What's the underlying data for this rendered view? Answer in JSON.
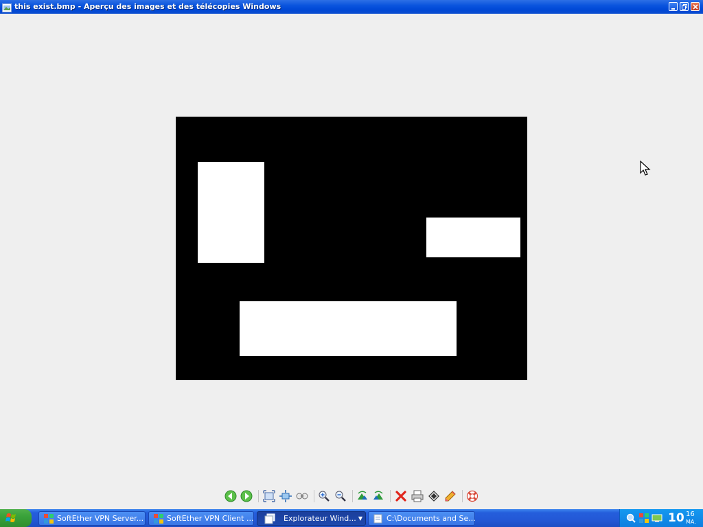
{
  "window": {
    "title": "this exist.bmp - Aperçu des images et des télécopies Windows",
    "buttons": [
      "minimize",
      "restore",
      "close"
    ]
  },
  "image": {
    "background_color": "#000000",
    "shape_color": "#ffffff"
  },
  "toolbar": {
    "buttons": [
      "previous-image",
      "next-image",
      "best-fit",
      "actual-size",
      "start-slideshow",
      "zoom-in",
      "zoom-out",
      "rotate-clockwise",
      "rotate-counterclockwise",
      "delete",
      "print",
      "copy-to",
      "edit",
      "help"
    ]
  },
  "taskbar": {
    "start_label": "",
    "tasks": [
      {
        "label": "SoftEther VPN Server...",
        "icon": "softether-icon",
        "active": false
      },
      {
        "label": "SoftEther VPN Client ...",
        "icon": "softether-icon",
        "active": false
      },
      {
        "label": "Explorateur Wind...",
        "icon": "explorer-group-icon",
        "active": true
      },
      {
        "label": "C:\\Documents and Se...",
        "icon": "folder-icon",
        "active": false
      }
    ],
    "tray": {
      "icons": [
        "search-tray-icon",
        "network-tray-icon",
        "monitor-tray-icon"
      ],
      "clock_hour": "10",
      "clock_minute": "16",
      "clock_ampm": "MA."
    }
  },
  "colors": {
    "titlebar_blue": "#0a54de",
    "desktop_bg": "#efefef",
    "taskbar_blue": "#245edc",
    "start_green": "#39a23a"
  }
}
